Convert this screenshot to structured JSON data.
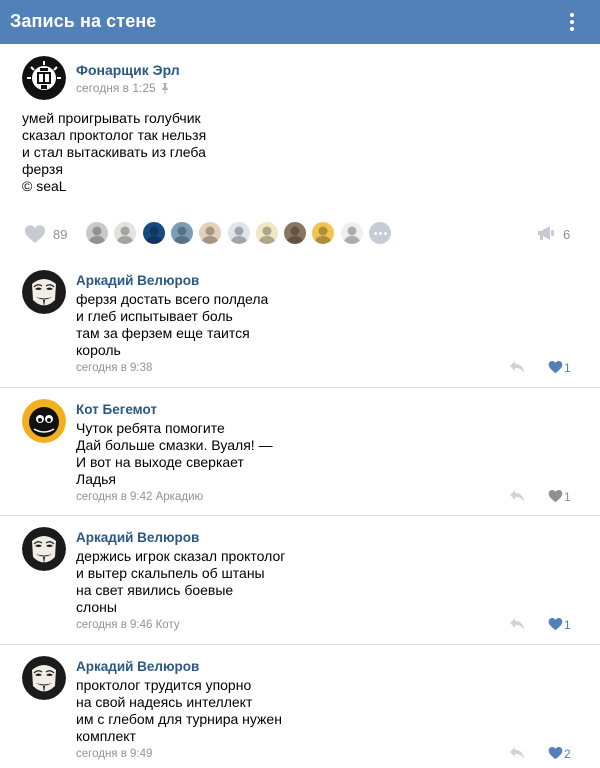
{
  "header": {
    "title": "Запись на стене"
  },
  "post": {
    "author": "Фонарщик Эрл",
    "time": "сегодня в 1:25",
    "lines": [
      "умей проигрывать голубчик",
      "сказал проктолог так нельзя",
      "и стал вытаскивать из глеба",
      "ферзя",
      "© seaL"
    ],
    "likes_count": "89",
    "shares_count": "6",
    "liker_avatar_colors": [
      "#c9c9c9",
      "#e1e3e0",
      "#174a83",
      "#7d9db6",
      "#e5d1b8",
      "#dfe5ed",
      "#f1e7c0",
      "#8a7462",
      "#f0c44f",
      "#efefef"
    ]
  },
  "comments": [
    {
      "author": "Аркадий Велюров",
      "lines": [
        "ферзя достать всего полдела",
        "и глеб испытывает боль",
        "там за ферзем еще таится",
        "король"
      ],
      "time": "сегодня в 9:38",
      "reply_to": "",
      "likes": "1",
      "liked": true,
      "avatar": "mask"
    },
    {
      "author": "Кот Бегемот",
      "lines": [
        "Чуток ребята помогите",
        "Дай больше смазки. Вуаля! —",
        "И вот на выходе сверкает",
        "Ладья"
      ],
      "time": "сегодня в 9:42",
      "reply_to": "Аркадию",
      "likes": "1",
      "liked": false,
      "avatar": "cat"
    },
    {
      "author": "Аркадий Велюров",
      "lines": [
        "держись игрок сказал проктолог",
        "и вытер скальпель об штаны",
        "на свет явились боевые",
        "слоны"
      ],
      "time": "сегодня в 9:46",
      "reply_to": "Коту",
      "likes": "1",
      "liked": true,
      "avatar": "mask"
    },
    {
      "author": "Аркадий Велюров",
      "lines": [
        "проктолог трудится упорно",
        "на свой надеясь интеллект",
        "им с глебом для турнира нужен",
        "комплект"
      ],
      "time": "сегодня в 9:49",
      "reply_to": "",
      "likes": "2",
      "liked": true,
      "avatar": "mask"
    }
  ],
  "colors": {
    "header_bg": "#5181b8",
    "link": "#2a5885",
    "meta": "#939393",
    "liked": "#5181b8",
    "unliked": "#909090"
  }
}
